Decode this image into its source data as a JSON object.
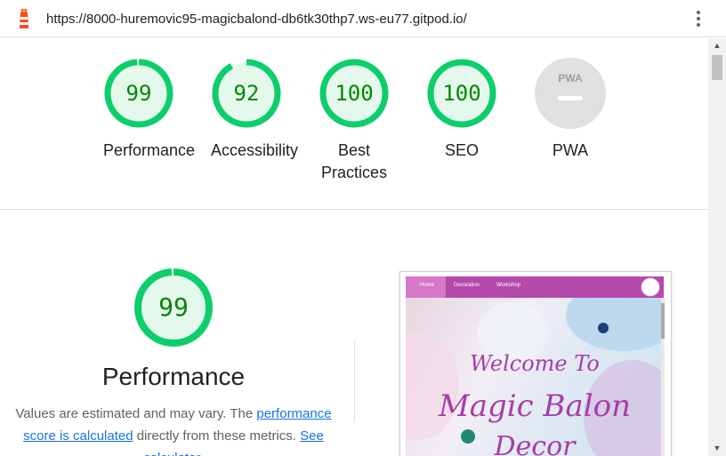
{
  "browser": {
    "url": "https://8000-huremovic95-magicbalond-db6tk30thp7.ws-eu77.gitpod.io/"
  },
  "colors": {
    "pass": "#0cce6b",
    "pass_fill": "#e5f8ec",
    "pass_text": "#008800",
    "na": "#e0e0e0",
    "link": "#1a73e8"
  },
  "scores": [
    {
      "label": "Performance",
      "value": "99",
      "score": 0.99
    },
    {
      "label": "Accessibility",
      "value": "92",
      "score": 0.92
    },
    {
      "label": "Best Practices",
      "value": "100",
      "score": 1.0
    },
    {
      "label": "SEO",
      "value": "100",
      "score": 1.0
    },
    {
      "label": "PWA",
      "icon": "pwa-icon",
      "icon_text": "PWA"
    }
  ],
  "performance": {
    "score": "99",
    "score_fraction": 0.99,
    "title": "Performance",
    "desc_1": "Values are estimated and may vary. The ",
    "link_1": "performance score is calculated",
    "desc_2": " directly from these metrics. ",
    "link_2": "See calculator."
  },
  "screenshot": {
    "nav": [
      "Home",
      "Decoration",
      "Workshop"
    ],
    "heading_1": "Welcome To",
    "heading_2": "Magic Balon",
    "heading_3": "Decor"
  },
  "icons": {
    "menu": "kebab-menu-icon",
    "app": "lighthouse-icon",
    "scroll_up": "▲",
    "scroll_down": "▼"
  }
}
